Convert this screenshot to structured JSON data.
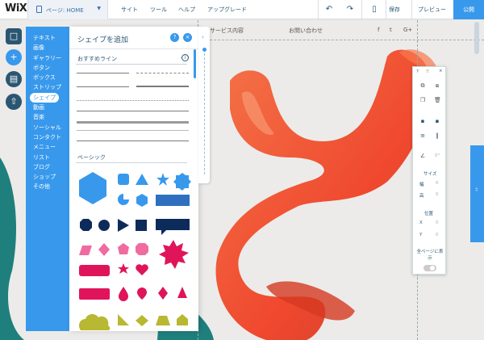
{
  "topbar": {
    "logo": "WiX",
    "page_selector": "ページ: HOME",
    "menu": [
      "サイト",
      "ツール",
      "ヘルプ",
      "アップグレード"
    ],
    "save": "保存",
    "preview": "プレビュー",
    "publish": "公開"
  },
  "site": {
    "menu_items": [
      "サービス内容",
      "お問い合わせ"
    ],
    "social": [
      "f",
      "t",
      "G+"
    ]
  },
  "categories": [
    "テキスト",
    "画像",
    "ギャラリー",
    "ボタン",
    "ボックス",
    "ストリップ",
    "シェイプ",
    "動画",
    "音楽",
    "ソーシャル",
    "コンタクト",
    "メニュー",
    "リスト",
    "ブログ",
    "ショップ",
    "その他"
  ],
  "add_panel": {
    "title": "シェイプを追加",
    "help": "?",
    "close": "×",
    "section_lines": "おすすめライン",
    "section_basic": "ベーシック"
  },
  "inspector": {
    "help": "?",
    "close": "×",
    "angle": "0°",
    "size_label": "サイズ",
    "width_label": "幅",
    "width_value": "0",
    "height_label": "高",
    "height_value": "0",
    "position_label": "位置",
    "x_label": "X",
    "x_value": "0",
    "y_label": "Y",
    "y_value": "0",
    "all_pages_label": "全ページに表示"
  },
  "colors": {
    "accent": "#3899ec",
    "navy": "#0d2b5a",
    "pink": "#f06ba0",
    "crimson": "#e0145a",
    "olive": "#b8b832",
    "orange": "#f2552a"
  }
}
